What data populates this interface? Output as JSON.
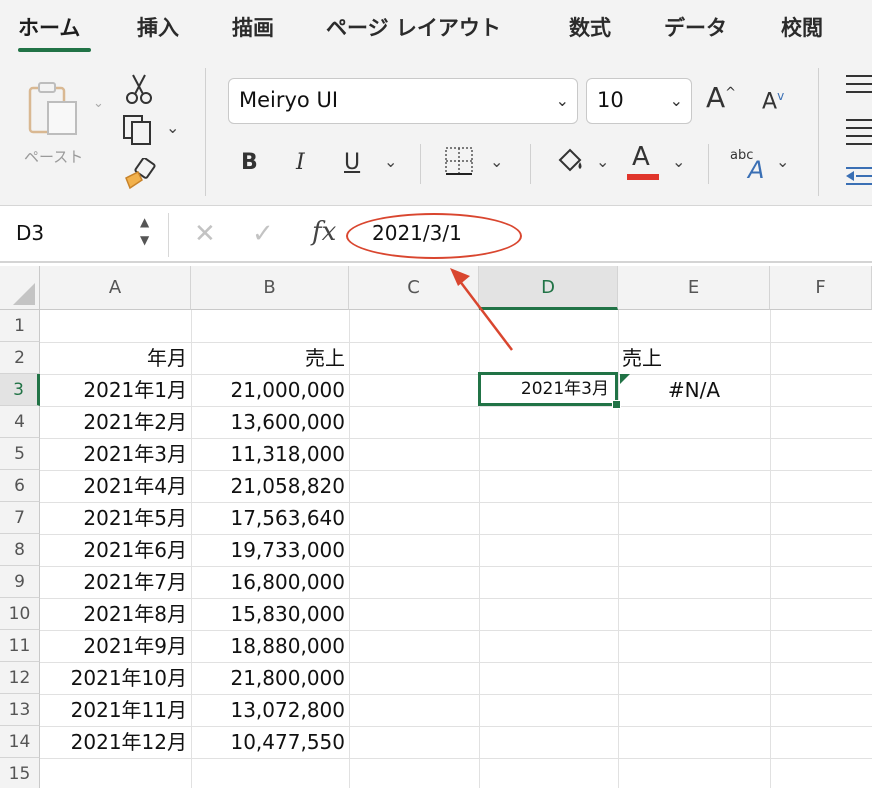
{
  "ribbon": {
    "tabs": [
      "ホーム",
      "挿入",
      "描画",
      "ページ レイアウト",
      "数式",
      "データ",
      "校閲"
    ],
    "paste_label": "ペースト",
    "font_name": "Meiryo UI",
    "font_size": "10",
    "bold_label": "B",
    "italic_label": "I",
    "underline_label": "U",
    "grow_font_label": "A",
    "shrink_font_label": "A",
    "font_color_label": "A",
    "abc_label": "abc",
    "font_color_swatch": "#e0352b",
    "accent": "#217346"
  },
  "formula_bar": {
    "name_box": "D3",
    "fx_label": "fx",
    "formula": "2021/3/1"
  },
  "sheet": {
    "columns": [
      "A",
      "B",
      "C",
      "D",
      "E",
      "F"
    ],
    "rows": [
      "1",
      "2",
      "3",
      "4",
      "5",
      "6",
      "7",
      "8",
      "9",
      "10",
      "11",
      "12",
      "13",
      "14",
      "15"
    ],
    "active_cell": "D3",
    "header_A": "年月",
    "header_B": "売上",
    "data": [
      {
        "month": "2021年1月",
        "sales": "21,000,000"
      },
      {
        "month": "2021年2月",
        "sales": "13,600,000"
      },
      {
        "month": "2021年3月",
        "sales": "11,318,000"
      },
      {
        "month": "2021年4月",
        "sales": "21,058,820"
      },
      {
        "month": "2021年5月",
        "sales": "17,563,640"
      },
      {
        "month": "2021年6月",
        "sales": "19,733,000"
      },
      {
        "month": "2021年7月",
        "sales": "16,800,000"
      },
      {
        "month": "2021年8月",
        "sales": "15,830,000"
      },
      {
        "month": "2021年9月",
        "sales": "18,880,000"
      },
      {
        "month": "2021年10月",
        "sales": "21,800,000"
      },
      {
        "month": "2021年11月",
        "sales": "13,072,800"
      },
      {
        "month": "2021年12月",
        "sales": "10,477,550"
      }
    ],
    "E2": "売上",
    "D3": "2021年3月",
    "E3": "#N/A"
  },
  "annotation": {
    "color": "#d9462f"
  }
}
